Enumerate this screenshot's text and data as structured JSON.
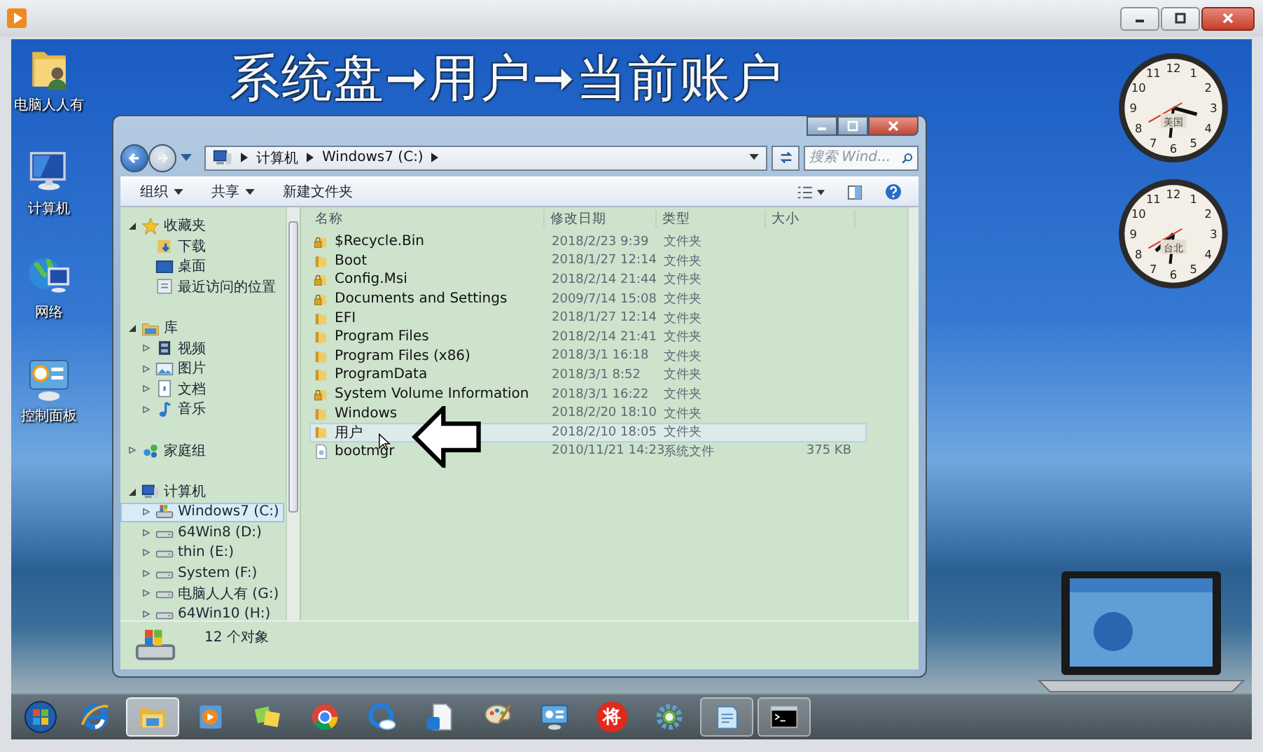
{
  "overlay_title": "系统盘➞用户➞当前账户",
  "desktop_icons": [
    {
      "label": "电脑人人有",
      "kind": "user-folder"
    },
    {
      "label": "计算机",
      "kind": "computer"
    },
    {
      "label": "网络",
      "kind": "network"
    },
    {
      "label": "控制面板",
      "kind": "control-panel"
    }
  ],
  "clocks": [
    {
      "label": "美国",
      "numerals": [
        "11",
        "12",
        "1",
        "10",
        "2",
        "9",
        "3",
        "8",
        "4",
        "7",
        "6",
        "5"
      ]
    },
    {
      "label": "台北",
      "numerals": [
        "11",
        "12",
        "1",
        "10",
        "2",
        "9",
        "3",
        "8",
        "4",
        "7",
        "6",
        "5"
      ]
    }
  ],
  "explorer": {
    "address": [
      "计算机",
      "Windows7 (C:)"
    ],
    "search": {
      "placeholder": "搜索 Wind..."
    },
    "toolbar": [
      {
        "label": "组织",
        "dropdown": true
      },
      {
        "label": "共享",
        "dropdown": true
      },
      {
        "label": "新建文件夹",
        "dropdown": false
      }
    ],
    "nav_pane": [
      {
        "label": "收藏夹",
        "kind": "favorites",
        "expanded": true,
        "selected": false,
        "children": [
          {
            "label": "下载",
            "kind": "downloads",
            "selected": false
          },
          {
            "label": "桌面",
            "kind": "desktop",
            "selected": false
          },
          {
            "label": "最近访问的位置",
            "kind": "recent",
            "selected": false
          }
        ]
      },
      {
        "label": "库",
        "kind": "library",
        "expanded": true,
        "selected": false,
        "children": [
          {
            "label": "视频",
            "kind": "video",
            "expanded": false,
            "selected": false
          },
          {
            "label": "图片",
            "kind": "picture",
            "expanded": false,
            "selected": false
          },
          {
            "label": "文档",
            "kind": "document",
            "expanded": false,
            "selected": false
          },
          {
            "label": "音乐",
            "kind": "music",
            "expanded": false,
            "selected": false
          }
        ]
      },
      {
        "label": "家庭组",
        "kind": "homegroup",
        "expanded": false,
        "selected": false
      },
      {
        "label": "计算机",
        "kind": "computer",
        "expanded": true,
        "selected": false,
        "children": [
          {
            "label": "Windows7 (C:)",
            "kind": "system-drive",
            "expanded": false,
            "selected": true
          },
          {
            "label": "64Win8  (D:)",
            "kind": "drive",
            "expanded": false,
            "selected": false
          },
          {
            "label": "thin (E:)",
            "kind": "drive",
            "expanded": false,
            "selected": false
          },
          {
            "label": "System (F:)",
            "kind": "drive",
            "expanded": false,
            "selected": false
          },
          {
            "label": "电脑人人有 (G:)",
            "kind": "drive",
            "expanded": false,
            "selected": false
          },
          {
            "label": "64Win10 (H:)",
            "kind": "drive",
            "expanded": false,
            "selected": false
          }
        ]
      }
    ],
    "columns": [
      "名称",
      "修改日期",
      "类型",
      "大小"
    ],
    "rows": [
      {
        "name": "$Recycle.Bin",
        "date": "2018/2/23 9:39",
        "type": "文件夹",
        "kind": "locked-folder",
        "selected": false
      },
      {
        "name": "Boot",
        "date": "2018/1/27 12:14",
        "type": "文件夹",
        "kind": "folder",
        "selected": false
      },
      {
        "name": "Config.Msi",
        "date": "2018/2/14 21:44",
        "type": "文件夹",
        "kind": "locked-folder",
        "selected": false
      },
      {
        "name": "Documents and Settings",
        "date": "2009/7/14 15:08",
        "type": "文件夹",
        "kind": "locked-folder",
        "selected": false
      },
      {
        "name": "EFI",
        "date": "2018/1/27 12:14",
        "type": "文件夹",
        "kind": "folder",
        "selected": false
      },
      {
        "name": "Program Files",
        "date": "2018/2/14 21:41",
        "type": "文件夹",
        "kind": "folder",
        "selected": false
      },
      {
        "name": "Program Files (x86)",
        "date": "2018/3/1 16:18",
        "type": "文件夹",
        "kind": "folder",
        "selected": false
      },
      {
        "name": "ProgramData",
        "date": "2018/3/1 8:52",
        "type": "文件夹",
        "kind": "folder",
        "selected": false
      },
      {
        "name": "System Volume Information",
        "date": "2018/3/1 16:22",
        "type": "文件夹",
        "kind": "locked-folder",
        "selected": false
      },
      {
        "name": "Windows",
        "date": "2018/2/20 18:10",
        "type": "文件夹",
        "kind": "folder",
        "selected": false
      },
      {
        "name": "用户",
        "date": "2018/2/10 18:05",
        "type": "文件夹",
        "kind": "folder",
        "selected": true
      },
      {
        "name": "bootmgr",
        "date": "2010/11/21 14:23",
        "type": "系统文件",
        "size": "375 KB",
        "kind": "file",
        "selected": false
      }
    ],
    "status": "12 个对象"
  },
  "taskbar": [
    {
      "kind": "start",
      "running": false,
      "selected": false
    },
    {
      "kind": "ie",
      "running": false,
      "selected": false
    },
    {
      "kind": "explorer",
      "running": true,
      "selected": true
    },
    {
      "kind": "media",
      "running": false,
      "selected": false
    },
    {
      "kind": "photos",
      "running": false,
      "selected": false
    },
    {
      "kind": "chrome",
      "running": false,
      "selected": false
    },
    {
      "kind": "qq",
      "running": false,
      "selected": false
    },
    {
      "kind": "file",
      "running": false,
      "selected": false
    },
    {
      "kind": "paint",
      "running": false,
      "selected": false
    },
    {
      "kind": "control-panel",
      "running": false,
      "selected": false
    },
    {
      "kind": "chess",
      "label": "将",
      "running": false,
      "selected": false
    },
    {
      "kind": "gear",
      "running": false,
      "selected": false
    },
    {
      "kind": "notepad",
      "running": true,
      "selected": false
    },
    {
      "kind": "cmd",
      "running": true,
      "selected": false
    }
  ]
}
